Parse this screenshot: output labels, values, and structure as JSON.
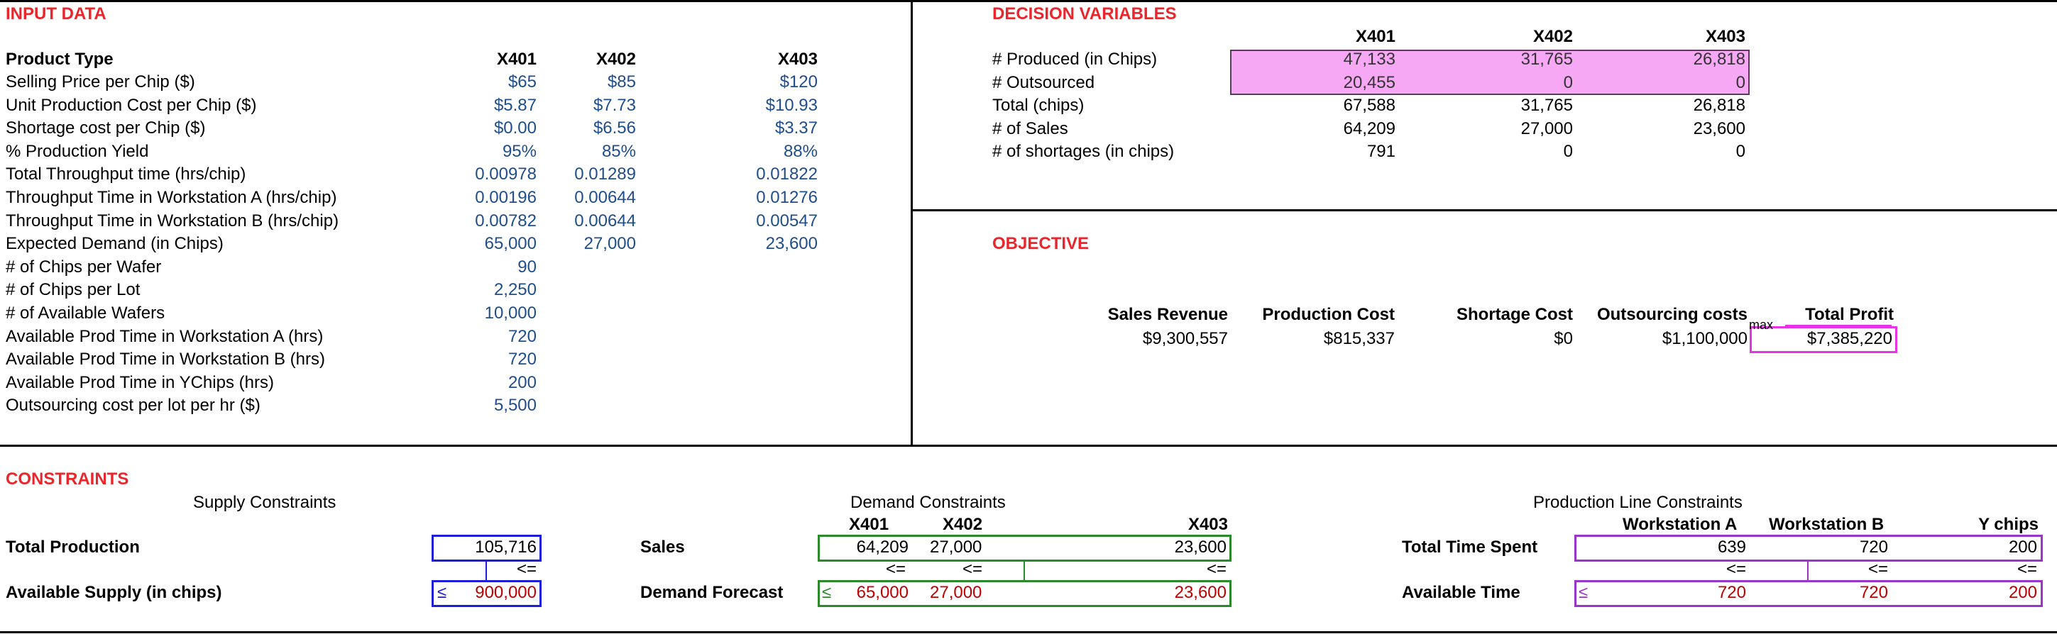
{
  "input": {
    "title": "INPUT DATA",
    "header": {
      "label": "Product Type",
      "cols": [
        "X401",
        "X402",
        "X403"
      ]
    },
    "rows": [
      {
        "label": "Selling Price per Chip ($)",
        "v": [
          "$65",
          "$85",
          "$120"
        ]
      },
      {
        "label": "Unit Production Cost per Chip ($)",
        "v": [
          "$5.87",
          "$7.73",
          "$10.93"
        ]
      },
      {
        "label": "Shortage cost per Chip ($)",
        "v": [
          "$0.00",
          "$6.56",
          "$3.37"
        ]
      },
      {
        "label": "% Production Yield",
        "v": [
          "95%",
          "85%",
          "88%"
        ]
      },
      {
        "label": "Total Throughput time (hrs/chip)",
        "v": [
          "0.00978",
          "0.01289",
          "0.01822"
        ]
      },
      {
        "label": "Throughput Time in Workstation A (hrs/chip)",
        "v": [
          "0.00196",
          "0.00644",
          "0.01276"
        ]
      },
      {
        "label": "Throughput Time in Workstation B (hrs/chip)",
        "v": [
          "0.00782",
          "0.00644",
          "0.00547"
        ]
      },
      {
        "label": "Expected Demand (in Chips)",
        "v": [
          "65,000",
          "27,000",
          "23,600"
        ]
      },
      {
        "label": "# of Chips per Wafer",
        "v": [
          "90",
          "",
          ""
        ]
      },
      {
        "label": "# of Chips per Lot",
        "v": [
          "2,250",
          "",
          ""
        ]
      },
      {
        "label": "# of Available Wafers",
        "v": [
          "10,000",
          "",
          ""
        ]
      },
      {
        "label": "Available Prod Time in Workstation A (hrs)",
        "v": [
          "720",
          "",
          ""
        ]
      },
      {
        "label": "Available Prod Time in Workstation B (hrs)",
        "v": [
          "720",
          "",
          ""
        ]
      },
      {
        "label": "Available Prod Time in YChips (hrs)",
        "v": [
          "200",
          "",
          ""
        ]
      },
      {
        "label": "Outsourcing cost per lot per hr ($)",
        "v": [
          "5,500",
          "",
          ""
        ]
      }
    ]
  },
  "decision": {
    "title": "DECISION VARIABLES",
    "cols": [
      "X401",
      "X402",
      "X403"
    ],
    "rows": [
      {
        "label": "# Produced (in Chips)",
        "v": [
          "47,133",
          "31,765",
          "26,818"
        ]
      },
      {
        "label": "# Outsourced",
        "v": [
          "20,455",
          "0",
          "0"
        ]
      },
      {
        "label": "Total (chips)",
        "v": [
          "67,588",
          "31,765",
          "26,818"
        ]
      },
      {
        "label": "# of Sales",
        "v": [
          "64,209",
          "27,000",
          "23,600"
        ]
      },
      {
        "label": "# of shortages (in chips)",
        "v": [
          "791",
          "0",
          "0"
        ]
      }
    ]
  },
  "objective": {
    "title": "OBJECTIVE",
    "headers": [
      "Sales Revenue",
      "Production Cost",
      "Shortage Cost",
      "Outsourcing costs",
      "Total Profit"
    ],
    "values": [
      "$9,300,557",
      "$815,337",
      "$0",
      "$1,100,000",
      "$7,385,220"
    ],
    "max_tag": "max"
  },
  "constraints": {
    "title": "CONSTRAINTS",
    "supply": {
      "title": "Supply Constraints",
      "row1_label": "Total Production",
      "row2_label": "Available Supply (in chips)",
      "lhs": "105,716",
      "op": "<=",
      "rhs": "900,000",
      "sign": "≤"
    },
    "demand": {
      "title": "Demand Constraints",
      "cols": [
        "X401",
        "X402",
        "X403"
      ],
      "row1_label": "Sales",
      "row2_label": "Demand Forecast",
      "lhs": [
        "64,209",
        "27,000",
        "23,600"
      ],
      "ops": [
        "<=",
        "<=",
        "<="
      ],
      "rhs": [
        "65,000",
        "27,000",
        "23,600"
      ],
      "sign": "≤"
    },
    "production": {
      "title": "Production Line Constraints",
      "cols": [
        "Workstation A",
        "Workstation B",
        "Y chips"
      ],
      "row1_label": "Total Time Spent",
      "row2_label": "Available Time",
      "lhs": [
        "639",
        "720",
        "200"
      ],
      "ops": [
        "<=",
        "<=",
        "<="
      ],
      "rhs": [
        "720",
        "720",
        "200"
      ],
      "sign": "≤"
    }
  },
  "colors": {
    "section_title": "#e8262c",
    "input_values": "#1f4e8c",
    "decision_fill": "#f7a8f5",
    "objective_box": "#e832e8",
    "supply_box": "#1c1cd9",
    "demand_box": "#2a8a2a",
    "production_box": "#9b35c9",
    "rhs_text": "#c00000"
  }
}
